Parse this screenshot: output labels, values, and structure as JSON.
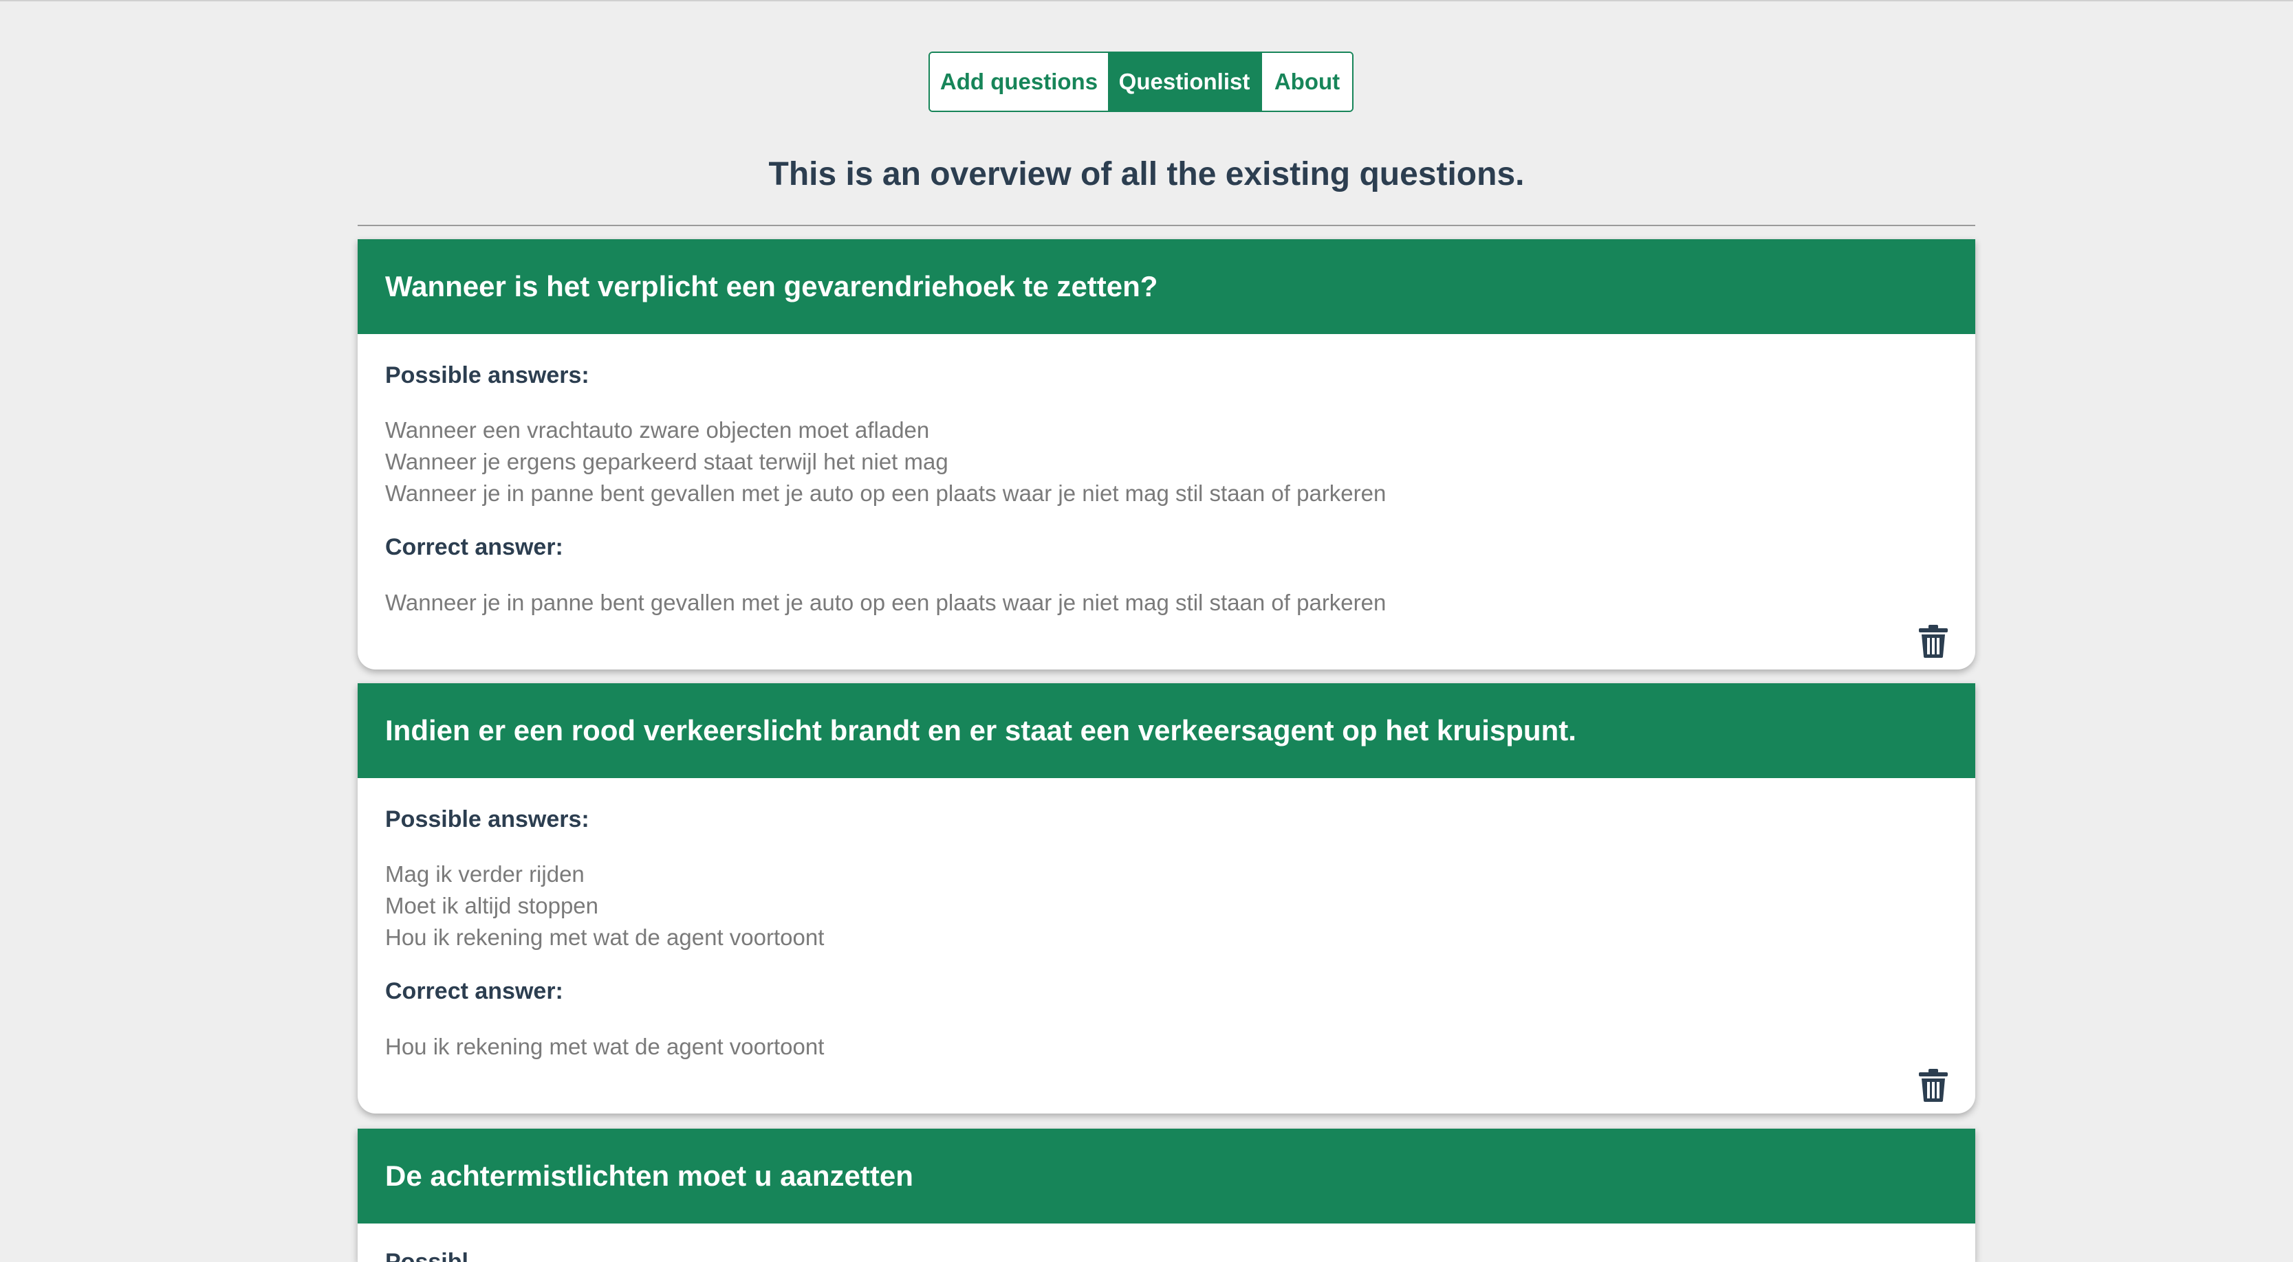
{
  "nav": {
    "tabs": [
      {
        "label": "Add questions",
        "active": false
      },
      {
        "label": "Questionlist",
        "active": true
      },
      {
        "label": "About",
        "active": false
      }
    ]
  },
  "page": {
    "title": "This is an overview of all the existing questions."
  },
  "labels": {
    "possible_answers": "Possible answers:",
    "correct_answer": "Correct answer:"
  },
  "questions": [
    {
      "question": "Wanneer is het verplicht een gevarendriehoek te zetten?",
      "answers": [
        "Wanneer een vrachtauto zware objecten moet afladen",
        "Wanneer je ergens geparkeerd staat terwijl het niet mag",
        "Wanneer je in panne bent gevallen met je auto op een plaats waar je niet mag stil staan of parkeren"
      ],
      "correct": "Wanneer je in panne bent gevallen met je auto op een plaats waar je niet mag stil staan of parkeren"
    },
    {
      "question": "Indien er een rood verkeerslicht brandt en er staat een verkeersagent op het kruispunt.",
      "answers": [
        "Mag ik verder rijden",
        "Moet ik altijd stoppen",
        "Hou ik rekening met wat de agent voortoont"
      ],
      "correct": "Hou ik rekening met wat de agent voortoont"
    },
    {
      "question": "De achtermistlichten moet u aanzetten",
      "partial_label": "Possibl"
    }
  ],
  "colors": {
    "accent": "#178559",
    "background": "#eeeeee",
    "heading": "#2c3e50",
    "muted_text": "#7a7a7a"
  },
  "icons": {
    "delete": "trash-icon"
  }
}
